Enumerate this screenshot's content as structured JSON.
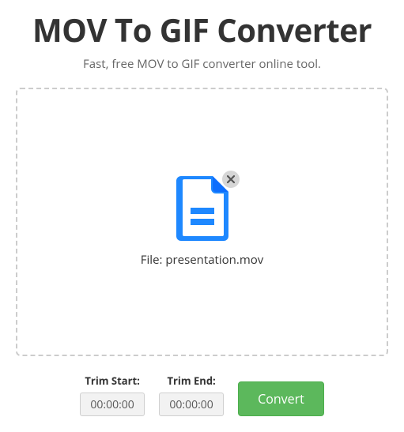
{
  "header": {
    "title": "MOV To GIF Converter",
    "subtitle": "Fast, free MOV to GIF converter online tool."
  },
  "dropzone": {
    "file_prefix": "File: ",
    "file_name": "presentation.mov"
  },
  "controls": {
    "trim_start_label": "Trim Start:",
    "trim_start_value": "00:00:00",
    "trim_end_label": "Trim End:",
    "trim_end_value": "00:00:00",
    "convert_label": "Convert"
  },
  "colors": {
    "accent_icon": "#1e88ff",
    "convert_bg": "#5cb85c"
  }
}
